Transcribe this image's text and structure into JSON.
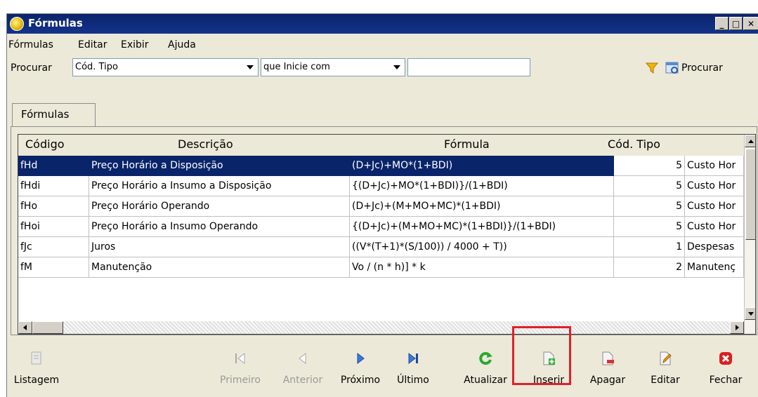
{
  "window": {
    "title": "Fórmulas"
  },
  "menu": [
    "Fórmulas",
    "Editar",
    "Exibir",
    "Ajuda"
  ],
  "search": {
    "label": "Procurar",
    "field_value": "Cód. Tipo",
    "condition_value": "que Inicie com",
    "text_value": "",
    "button_label": "Procurar"
  },
  "tab": {
    "label": "Fórmulas"
  },
  "grid": {
    "headers": [
      "Código",
      "Descrição",
      "Fórmula",
      "Cód. Tipo"
    ],
    "rows": [
      {
        "codigo": "fHd",
        "descricao": "Preço Horário a Disposição",
        "formula": "(D+Jc)+MO*(1+BDI)",
        "cod_tipo": "5",
        "tipo": "Custo Hor",
        "selected": true
      },
      {
        "codigo": "fHdi",
        "descricao": "Preço Horário a Insumo a Disposição",
        "formula": "{(D+Jc)+MO*(1+BDI)}/(1+BDI)",
        "cod_tipo": "5",
        "tipo": "Custo Hor"
      },
      {
        "codigo": "fHo",
        "descricao": "Preço Horário Operando",
        "formula": "(D+Jc)+(M+MO+MC)*(1+BDI)",
        "cod_tipo": "5",
        "tipo": "Custo Hor"
      },
      {
        "codigo": "fHoi",
        "descricao": "Preço Horário a Insumo Operando",
        "formula": "{(D+Jc)+(M+MO+MC)*(1+BDI)}/(1+BDI)",
        "cod_tipo": "5",
        "tipo": "Custo Hor"
      },
      {
        "codigo": "fJc",
        "descricao": "Juros",
        "formula": "((V*(T+1)*(S/100)) / 4000 + T))",
        "cod_tipo": "1",
        "tipo": "Despesas"
      },
      {
        "codigo": "fM",
        "descricao": "Manutenção",
        "formula": "Vo / (n * h)] * k",
        "cod_tipo": "2",
        "tipo": "Manutenç"
      }
    ]
  },
  "toolbar": {
    "listagem": "Listagem",
    "primeiro": "Primeiro",
    "anterior": "Anterior",
    "proximo": "Próximo",
    "ultimo": "Último",
    "atualizar": "Atualizar",
    "inserir": "Inserir",
    "apagar": "Apagar",
    "editar": "Editar",
    "fechar": "Fechar"
  },
  "colors": {
    "title_bar": "#0a246a",
    "selection": "#0a246a",
    "highlight_box": "#e0202a",
    "window_bg": "#ece9d8"
  }
}
